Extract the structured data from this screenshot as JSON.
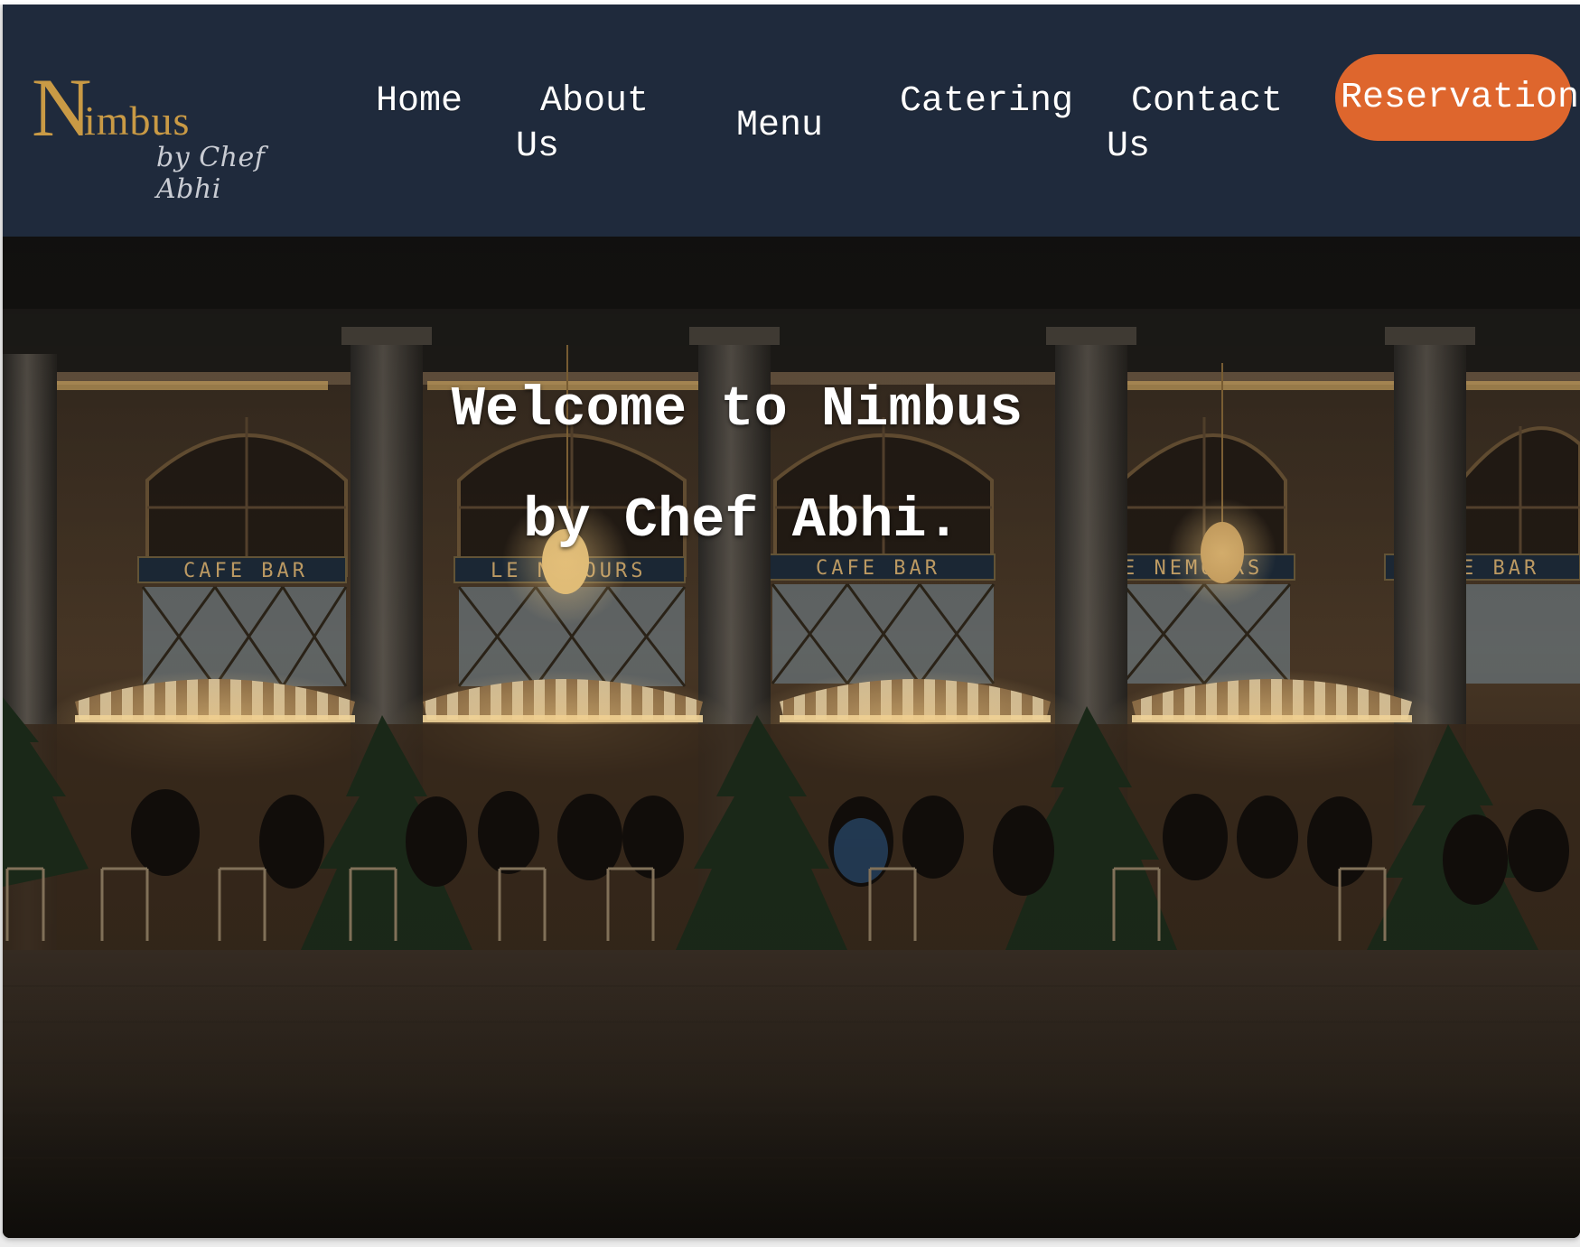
{
  "logo": {
    "initial": "N",
    "rest": "imbus",
    "tagline": "by Chef Abhi"
  },
  "nav": {
    "home": "Home",
    "about_line1": "About",
    "about_line2": "Us",
    "menu": "Menu",
    "catering": "Catering",
    "contact_line1": "Contact",
    "contact_line2": "Us",
    "reservation": "Reservation"
  },
  "hero": {
    "line1": "Welcome to Nimbus",
    "line2": "by Chef Abhi.",
    "photo_signs": [
      "CAFE BAR",
      "LE NEMOURS",
      "CAFE BAR",
      "LE NEMOURS",
      "CAFE BAR"
    ]
  },
  "colors": {
    "navbar_bg": "#1f2a3c",
    "logo_gold": "#c99a45",
    "reservation_orange": "#de662d",
    "text_white": "#ffffff"
  }
}
